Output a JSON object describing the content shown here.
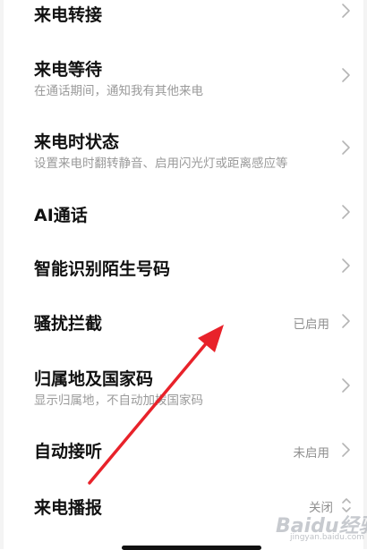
{
  "settings": {
    "items": [
      {
        "title": "来电转接"
      },
      {
        "title": "来电等待",
        "subtitle": "在通话期间，通知我有其他来电"
      },
      {
        "title": "来电时状态",
        "subtitle": "设置来电时翻转静音、启用闪光灯或距离感应等"
      },
      {
        "title": "AI通话"
      },
      {
        "title": "智能识别陌生号码"
      },
      {
        "title": "骚扰拦截",
        "value": "已启用"
      },
      {
        "title": "归属地及国家码",
        "subtitle": "显示归属地，不自动加拨国家码"
      },
      {
        "title": "自动接听",
        "value": "未启用"
      },
      {
        "title": "来电播报",
        "value": "关闭"
      }
    ]
  },
  "watermark": {
    "logo": "Baidu经验",
    "site": "jingyan.baidu.com"
  },
  "colors": {
    "arrow": "#e8222a",
    "chevron": "#b5b5b5",
    "secondary_text": "#9a9a9a"
  }
}
